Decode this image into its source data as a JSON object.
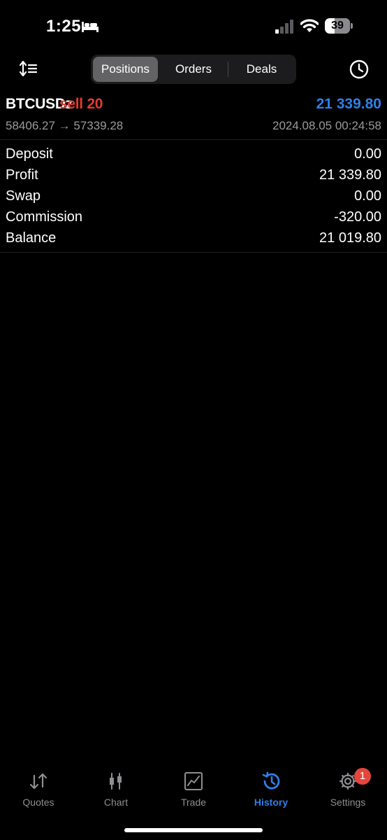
{
  "status_bar": {
    "time": "1:25",
    "battery": "39"
  },
  "toolbar": {
    "tabs": [
      {
        "label": "Positions",
        "active": true
      },
      {
        "label": "Orders",
        "active": false
      },
      {
        "label": "Deals",
        "active": false
      }
    ],
    "icons": [
      "sort-icon",
      "clock-icon"
    ]
  },
  "position": {
    "symbol": "BTCUSDz",
    "direction": "sell 20",
    "prices": "58406.27 → 57339.28",
    "datetime": "2024.08.05 00:24:58",
    "profit": "21 339.80"
  },
  "summary": [
    {
      "label": "Deposit",
      "value": "0.00"
    },
    {
      "label": "Profit",
      "value": "21 339.80"
    },
    {
      "label": "Swap",
      "value": "0.00"
    },
    {
      "label": "Commission",
      "value": "-320.00"
    },
    {
      "label": "Balance",
      "value": "21 019.80"
    }
  ],
  "tab_bar": {
    "tabs": [
      {
        "label": "Quotes",
        "icon": "quotes-icon",
        "active": false
      },
      {
        "label": "Chart",
        "icon": "chart-icon",
        "active": false
      },
      {
        "label": "Trade",
        "icon": "trade-icon",
        "active": false
      },
      {
        "label": "History",
        "icon": "history-icon",
        "active": true
      },
      {
        "label": "Settings",
        "icon": "settings-icon",
        "active": false
      }
    ],
    "settings_badge": "1"
  },
  "colors": {
    "accent": "#2f7fe8",
    "sell": "#e03c31",
    "muted": "#9a9a9e",
    "badge": "#e5463b"
  }
}
